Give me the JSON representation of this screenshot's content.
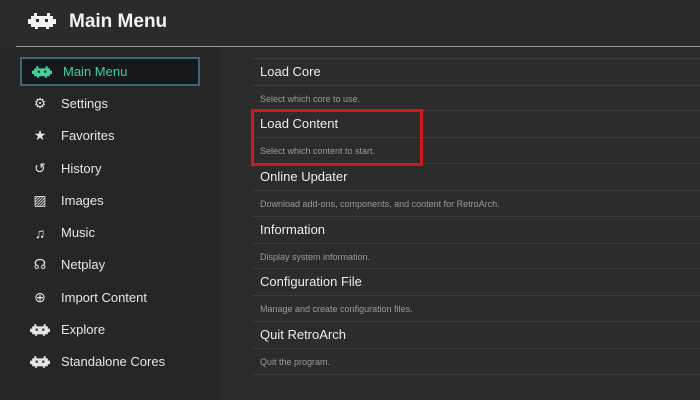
{
  "header": {
    "title": "Main Menu"
  },
  "sidebar": {
    "items": [
      {
        "label": "Main Menu",
        "icon": "retroarch-invader-icon",
        "selected": true
      },
      {
        "label": "Settings",
        "icon": "gear-icon"
      },
      {
        "label": "Favorites",
        "icon": "star-icon"
      },
      {
        "label": "History",
        "icon": "history-icon"
      },
      {
        "label": "Images",
        "icon": "image-icon"
      },
      {
        "label": "Music",
        "icon": "music-note-icon"
      },
      {
        "label": "Netplay",
        "icon": "headset-icon"
      },
      {
        "label": "Import Content",
        "icon": "plus-circle-icon"
      },
      {
        "label": "Explore",
        "icon": "retroarch-invader-icon"
      },
      {
        "label": "Standalone Cores",
        "icon": "retroarch-invader-icon"
      }
    ]
  },
  "main": {
    "items": [
      {
        "title": "Load Core",
        "desc": "Select which core to use."
      },
      {
        "title": "Load Content",
        "desc": "Select which content to start."
      },
      {
        "title": "Online Updater",
        "desc": "Download add-ons, components, and content for RetroArch."
      },
      {
        "title": "Information",
        "desc": "Display system information."
      },
      {
        "title": "Configuration File",
        "desc": "Manage and create configuration files."
      },
      {
        "title": "Quit RetroArch",
        "desc": "Quit the program."
      }
    ]
  },
  "colors": {
    "accent": "#3fd29a",
    "highlight": "#d01818"
  }
}
